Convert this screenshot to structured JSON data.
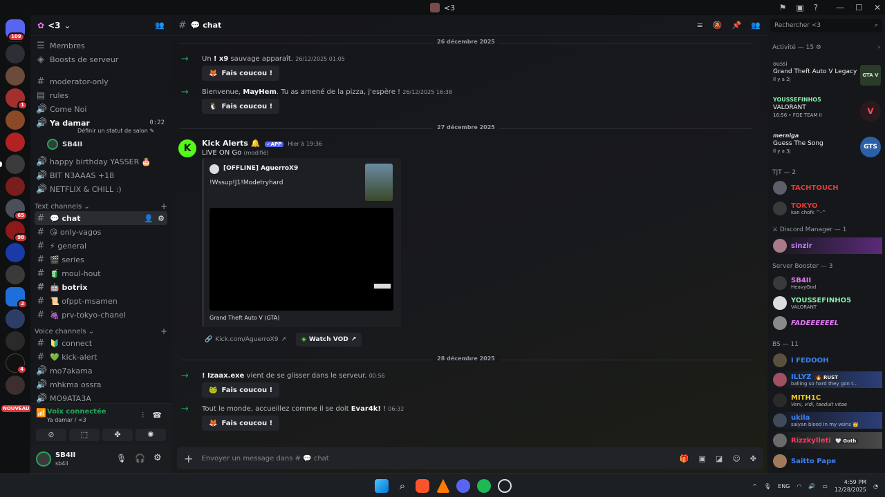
{
  "window": {
    "title": "<3"
  },
  "server": {
    "name": "<3",
    "rail_badges": [
      "109",
      "1",
      "65",
      "98",
      "2",
      "4"
    ],
    "new_badge": "NOUVEAU"
  },
  "sidebar": {
    "top_items": [
      {
        "label": "Membres"
      },
      {
        "label": "Boosts de serveur"
      }
    ],
    "channels_misc": [
      {
        "label": "moderator-only"
      },
      {
        "label": "rules"
      },
      {
        "label": "Come Noi"
      },
      {
        "label": "Ya damar",
        "time": "0:22",
        "status_prompt": "Définir un statut de salon"
      },
      {
        "label": "SB4II"
      },
      {
        "label": "happy birthday YASSER 🎂"
      },
      {
        "label": "BIT N3AAAS +18"
      },
      {
        "label": "NETFLIX & CHILL :)"
      }
    ],
    "text_category": "Text channels",
    "text_channels": [
      {
        "label": "💬 chat"
      },
      {
        "label": "😘 only-vagos"
      },
      {
        "label": "⚡ general"
      },
      {
        "label": "🎬 series"
      },
      {
        "label": "🧃 moul-hout"
      },
      {
        "label": "🤖 botrix"
      },
      {
        "label": "📜 ofppt-msamen"
      },
      {
        "label": "🍇 prv-tokyo-chanel"
      }
    ],
    "voice_category": "Voice channels",
    "voice_channels": [
      {
        "label": "🔰 connect"
      },
      {
        "label": "💚 kick-alert"
      },
      {
        "label": "mo7akama"
      },
      {
        "label": "mhkma ossra"
      },
      {
        "label": "MO9ATA3A"
      }
    ],
    "voice_status": {
      "title": "Voix connectée",
      "subtitle": "Ya damar / <3"
    },
    "user": {
      "display": "SB4II",
      "handle": "sb4ii"
    }
  },
  "main": {
    "channel_title": "💬 chat",
    "dates": [
      "26 décembre 2025",
      "27 décembre 2025",
      "28 décembre 2025"
    ],
    "messages": [
      {
        "pre": "Un ",
        "name": "! x9",
        "post": " sauvage apparaît.",
        "ts": "26/12/2025 01:05",
        "button": "Fais coucou !"
      },
      {
        "pre": "Bienvenue, ",
        "name": "MayHem",
        "post": ". Tu as amené de la pizza, j'espère !",
        "ts": "26/12/2025 16:38",
        "button": "Fais coucou !"
      },
      {
        "pre": "",
        "name": "! Izaax.exe",
        "post": " vient de se glisser dans le serveur.",
        "ts": "00:56",
        "button": "Fais coucou !"
      },
      {
        "pre": "Tout le monde, accueillez comme il se doit ",
        "name": "Evar4k!",
        "post": " !",
        "ts": "06:32",
        "button": "Fais coucou !"
      }
    ],
    "bot": {
      "name": "Kick Alerts 🔔",
      "tag": "✓APP",
      "time": "Hier à 19:36",
      "text": "LIVE ON Go",
      "edited": "(modifié)",
      "embed_author": "[OFFLINE] AguerroX9",
      "embed_desc": "!Wssup!J1!Modetryhard",
      "embed_footer": "Grand Theft Auto V (GTA)",
      "link1": "Kick.com/AguerroX9",
      "link2": "Watch VOD"
    },
    "composer_placeholder": "Envoyer un message dans # 💬 chat"
  },
  "members": {
    "search_placeholder": "Rechercher <3",
    "activity_header": "Activité — 15",
    "activities": [
      {
        "who": "oussi",
        "game": "Grand Theft Auto V Legacy",
        "time": "Il y a 2j",
        "logo": "GTA V"
      },
      {
        "who": "YOUSSEFINHO5",
        "game": "VALORANT",
        "time": "16:56 • FOE TEAM II",
        "logo": "V"
      },
      {
        "who": "merniga",
        "game": "Guess The Song",
        "time": "Il y a 3j",
        "logo": "GTS"
      }
    ],
    "groups": [
      {
        "title": "TJT — 2",
        "members": [
          {
            "name": "TACHTOUCH",
            "status": "",
            "color": "#e53935"
          },
          {
            "name": "TOKYO",
            "status": "kan chofk ^-^",
            "color": "#e53935"
          }
        ]
      },
      {
        "title": "⚔ Discord Manager — 1",
        "members": [
          {
            "name": "sinzir",
            "status": "",
            "color": "#c084fc"
          }
        ]
      },
      {
        "title": "Server Booster — 3",
        "members": [
          {
            "name": "SB4II",
            "status": "HeavyGod",
            "color": "#e879f9"
          },
          {
            "name": "YOUSSEFINHO5",
            "status": "VALORANT",
            "color": "#86efac"
          },
          {
            "name": "FADEEEEEEL",
            "status": "",
            "color": "#e879f9"
          }
        ]
      },
      {
        "title": "BS — 11",
        "members": [
          {
            "name": "I FEDOOH",
            "status": "",
            "color": "#3b82f6"
          },
          {
            "name": "ILLYZ",
            "status": "balling so hard they gon t...",
            "color": "#3b82f6",
            "tag": "🔥 RUST"
          },
          {
            "name": "MITH1C",
            "status": "Veni, vidi, taeduit vitae",
            "color": "#facc15"
          },
          {
            "name": "ukila",
            "status": "saiyan blood in my veins 👑",
            "color": "#3b82f6"
          },
          {
            "name": "Rizzkylleti",
            "status": "",
            "color": "#f43f5e",
            "tag": "🤍 Goth"
          },
          {
            "name": "Saitto Pape",
            "status": "",
            "color": "#3b82f6"
          }
        ]
      }
    ]
  },
  "taskbar": {
    "lang": "ENG",
    "time": "4:59 PM",
    "date": "12/28/2025"
  }
}
